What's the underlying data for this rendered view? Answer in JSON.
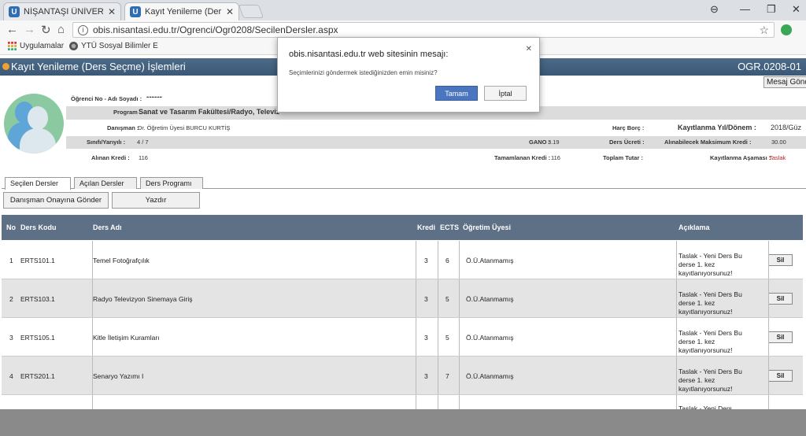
{
  "browser": {
    "tabs": [
      {
        "title": "NİŞANTAŞI ÜNİVERSİTES"
      },
      {
        "title": "Kayıt Yenileme (Ders Seçi"
      }
    ],
    "url": "obis.nisantasi.edu.tr/Ogrenci/Ogr0208/SecilenDersler.aspx",
    "bookmarks": [
      {
        "label": "Uygulamalar"
      },
      {
        "label": "YTÜ Sosyal Bilimler E"
      }
    ]
  },
  "page": {
    "title": "Kayıt Yenileme (Ders Seçme) İşlemleri",
    "code": "OGR.0208-01",
    "message_button": "Mesaj Gönd"
  },
  "student": {
    "no_label": "Öğrenci No - Adı Soyadı :",
    "no_value": "------",
    "program_label": "Program :",
    "program_value": "Sanat ve Tasarım Fakültesi/Radyo, Televiz",
    "advisor_label": "Danışman :",
    "advisor_value": "Dr. Öğretim Üyesi BURCU KURTİŞ",
    "fee_label": "Harç Borç :",
    "period_label": "Kayıtlanma Yıl/Dönem :",
    "period_value": "2018/Güz",
    "class_label": "Sınıfı/Yarıyılı :",
    "class_value": "4 / 7",
    "gano_label": "GANO :",
    "gano_value": "3.19",
    "course_fee_label": "Ders Ücreti :",
    "max_credit_label": "Alınabilecek Maksimum Kredi :",
    "max_credit_value": "30.00",
    "taken_credit_label": "Alınan Kredi :",
    "taken_credit_value": "116",
    "completed_credit_label": "Tamamlanan Kredi :",
    "completed_credit_value": "116",
    "total_label": "Toplam Tutar :",
    "stage_label": "Kayıtlanma Aşaması :",
    "stage_value": "Taslak"
  },
  "tabs": [
    {
      "label": "Seçilen Dersler"
    },
    {
      "label": "Açılan Dersler"
    },
    {
      "label": "Ders Programı"
    }
  ],
  "actions": {
    "send_label": "Danışman Onayına Gönder",
    "print_label": "Yazdır"
  },
  "table": {
    "headers": {
      "no": "No",
      "code": "Ders Kodu",
      "name": "Ders Adı",
      "credit": "Kredi",
      "ects": "ECTS",
      "instructor": "Öğretim Üyesi",
      "note": "Açıklama"
    },
    "rows": [
      {
        "no": "1",
        "code": "ERTS101.1",
        "name": "Temel Fotoğrafçılık",
        "credit": "3",
        "ects": "6",
        "instructor": "Ö.Ü.Atanmamış",
        "note": "Taslak - Yeni Ders Bu derse 1. kez kayıtlanıyorsunuz!",
        "action": "Sil"
      },
      {
        "no": "2",
        "code": "ERTS103.1",
        "name": "Radyo Televizyon Sinemaya Giriş",
        "credit": "3",
        "ects": "5",
        "instructor": "Ö.Ü.Atanmamış",
        "note": "Taslak - Yeni Ders Bu derse 1. kez kayıtlanıyorsunuz!",
        "action": "Sil"
      },
      {
        "no": "3",
        "code": "ERTS105.1",
        "name": "Kitle İletişim Kuramları",
        "credit": "3",
        "ects": "5",
        "instructor": "Ö.Ü.Atanmamış",
        "note": "Taslak - Yeni Ders Bu derse 1. kez kayıtlanıyorsunuz!",
        "action": "Sil"
      },
      {
        "no": "4",
        "code": "ERTS201.1",
        "name": "Senaryo Yazımı I",
        "credit": "3",
        "ects": "7",
        "instructor": "Ö.Ü.Atanmamış",
        "note": "Taslak - Yeni Ders Bu derse 1. kez kayıtlanıyorsunuz!",
        "action": "Sil"
      }
    ],
    "partial_note": "Taslak - Yeni Ders"
  },
  "dialog": {
    "title": "obis.nisantasi.edu.tr web sitesinin mesajı:",
    "message": "Seçimlerinizi göndermek istediğinizden emin misiniz?",
    "ok_label": "Tamam",
    "cancel_label": "İptal"
  },
  "colors": {
    "header_bar": "#4c6b88",
    "table_header": "#5d7086",
    "ok_button": "#4a76c0",
    "stage_red": "#c02020"
  }
}
